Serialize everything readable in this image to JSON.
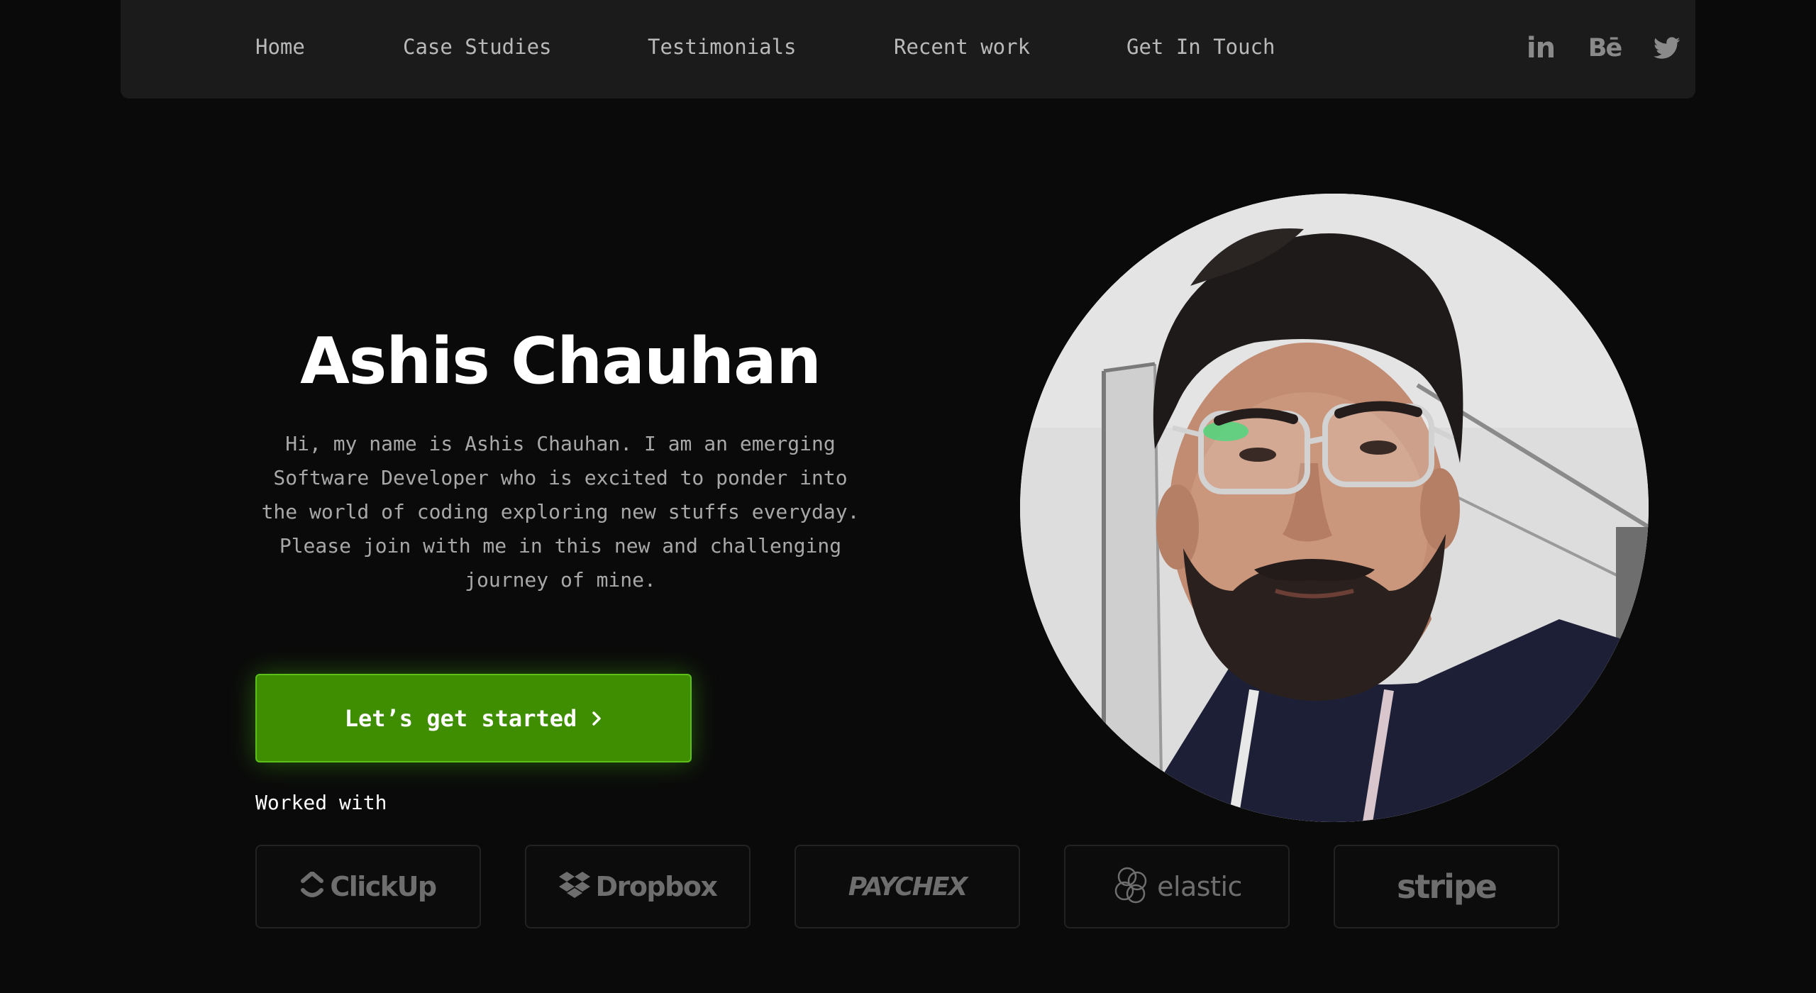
{
  "nav": {
    "links": [
      {
        "label": "Home"
      },
      {
        "label": "Case Studies"
      },
      {
        "label": "Testimonials"
      },
      {
        "label": "Recent work"
      },
      {
        "label": "Get In Touch"
      }
    ],
    "social": [
      {
        "icon": "linkedin-icon",
        "glyph": "in"
      },
      {
        "icon": "behance-icon",
        "glyph": "Bē"
      },
      {
        "icon": "twitter-icon"
      }
    ]
  },
  "hero": {
    "name": "Ashis Chauhan",
    "description": "Hi, my name is Ashis Chauhan. I am an emerging Software Developer who is excited to ponder into the world of coding exploring new stuffs everyday. Please join with me in this new and challenging journey of mine.",
    "cta_label": "Let’s get started",
    "avatar_icon": "profile-photo"
  },
  "worked_with": {
    "label": "Worked with",
    "brands": [
      {
        "name": "ClickUp",
        "icon": "clickup-logo-icon"
      },
      {
        "name": "Dropbox",
        "icon": "dropbox-logo-icon"
      },
      {
        "name": "PAYCHEX",
        "icon": "paychex-logo"
      },
      {
        "name": "elastic",
        "icon": "elastic-logo-icon"
      },
      {
        "name": "stripe",
        "icon": "stripe-logo"
      }
    ]
  },
  "colors": {
    "background": "#0a0a0a",
    "nav_background": "#1b1b1b",
    "accent": "#3f8d00",
    "accent_border": "#5cbf1a",
    "muted_text": "#a8a8a8",
    "brand_gray": "#6e6e6e"
  }
}
